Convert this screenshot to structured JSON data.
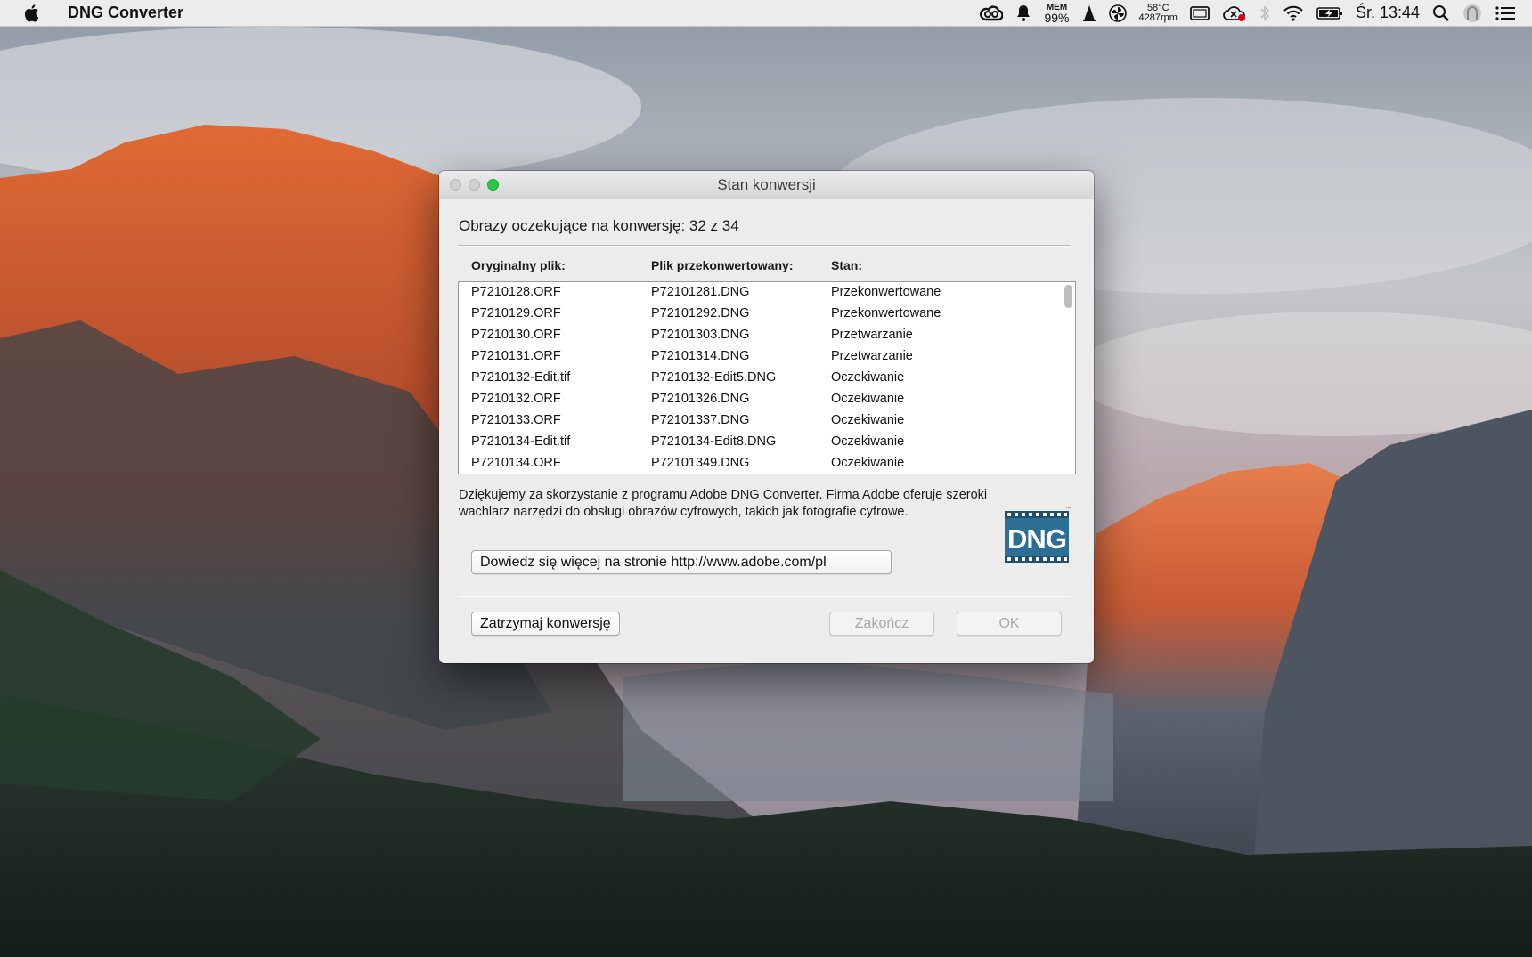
{
  "menubar": {
    "app_name": "DNG Converter",
    "mem_label": "MEM",
    "mem_value": "99%",
    "temp": "58°C",
    "fan": "4287rpm",
    "clock": "Śr. 13:44"
  },
  "window": {
    "title": "Stan konwersji",
    "pending_label": "Obrazy oczekujące na konwersję: 32 z 34",
    "columns": {
      "original": "Oryginalny plik:",
      "converted": "Plik przekonwertowany:",
      "status": "Stan:"
    },
    "rows": [
      {
        "original": "P7210128.ORF",
        "converted": "P72101281.DNG",
        "status": "Przekonwertowane"
      },
      {
        "original": "P7210129.ORF",
        "converted": "P72101292.DNG",
        "status": "Przekonwertowane"
      },
      {
        "original": "P7210130.ORF",
        "converted": "P72101303.DNG",
        "status": "Przetwarzanie"
      },
      {
        "original": "P7210131.ORF",
        "converted": "P72101314.DNG",
        "status": "Przetwarzanie"
      },
      {
        "original": "P7210132-Edit.tif",
        "converted": "P7210132-Edit5.DNG",
        "status": "Oczekiwanie"
      },
      {
        "original": "P7210132.ORF",
        "converted": "P72101326.DNG",
        "status": "Oczekiwanie"
      },
      {
        "original": "P7210133.ORF",
        "converted": "P72101337.DNG",
        "status": "Oczekiwanie"
      },
      {
        "original": "P7210134-Edit.tif",
        "converted": "P7210134-Edit8.DNG",
        "status": "Oczekiwanie"
      },
      {
        "original": "P7210134.ORF",
        "converted": "P72101349.DNG",
        "status": "Oczekiwanie"
      }
    ],
    "thanks_text": "Dziękujemy za skorzystanie z programu Adobe DNG Converter.  Firma Adobe oferuje szeroki wachlarz narzędzi do obsługi obrazów cyfrowych, takich jak fotografie cyfrowe.",
    "logo_text": "DNG",
    "learn_more_button": "Dowiedz się więcej na stronie http://www.adobe.com/pl",
    "stop_button": "Zatrzymaj konwersję",
    "finish_button": "Zakończ",
    "ok_button": "OK"
  },
  "colors": {
    "traffic_green": "#2ac840",
    "logo_blue": "#2d6e95"
  }
}
